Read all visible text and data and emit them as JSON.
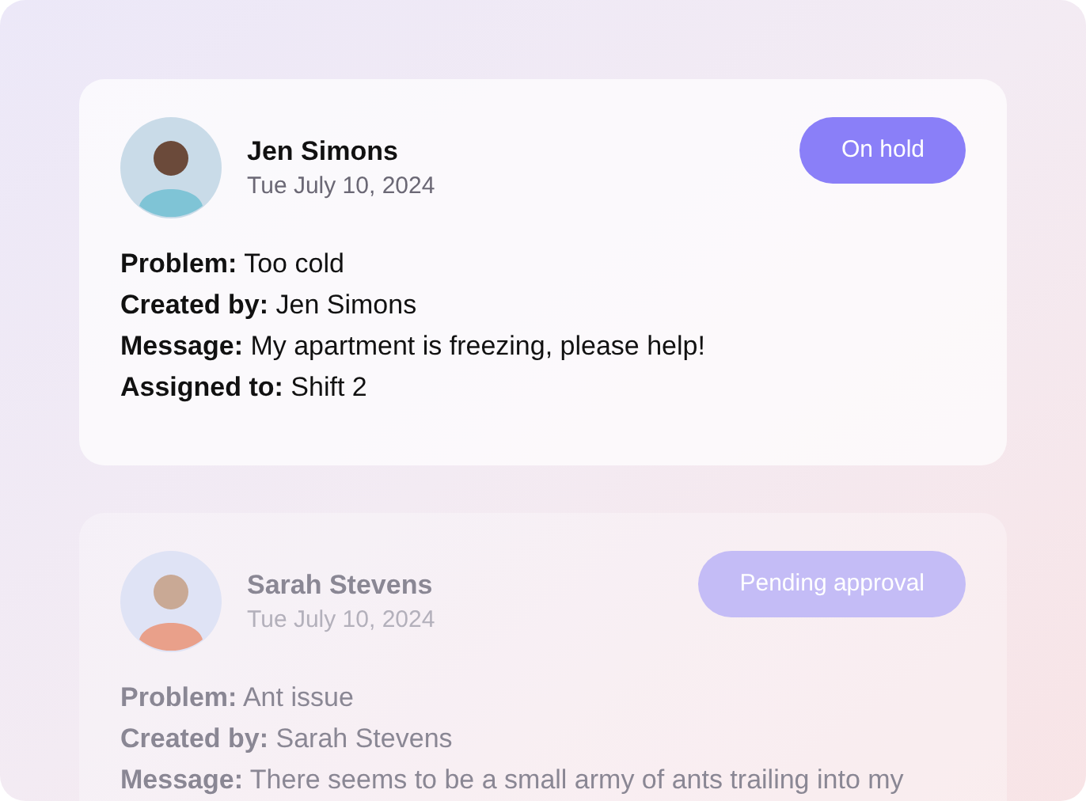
{
  "tickets": [
    {
      "name": "Jen Simons",
      "date": "Tue July 10, 2024",
      "status": "On hold",
      "dimmed": false,
      "lines": [
        "**Problem:** Too cold",
        "**Created by:** Jen Simons",
        "**Message:** My apartment is freezing, please help!",
        "**Assigned to:** Shift 2"
      ]
    },
    {
      "name": "Sarah Stevens",
      "date": "Tue July 10, 2024",
      "status": "Pending approval",
      "dimmed": true,
      "lines": [
        "**Problem:** Ant issue",
        "**Created by:** Sarah Stevens",
        "**Message:** There seems to be a small army of ants trailing into my"
      ]
    }
  ]
}
